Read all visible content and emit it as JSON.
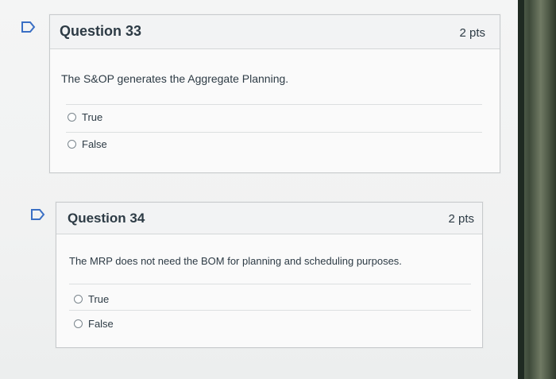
{
  "questions": [
    {
      "title": "Question 33",
      "points": "2 pts",
      "text": "The S&OP generates the Aggregate Planning.",
      "answers": [
        "True",
        "False"
      ]
    },
    {
      "title": "Question 34",
      "points": "2 pts",
      "text": "The MRP does not need the BOM for planning and scheduling purposes.",
      "answers": [
        "True",
        "False"
      ]
    }
  ],
  "colors": {
    "flag": "#3a6fc4",
    "text": "#2d3b45"
  },
  "icons": {
    "flag": "flag-icon",
    "radio": "radio-button"
  }
}
